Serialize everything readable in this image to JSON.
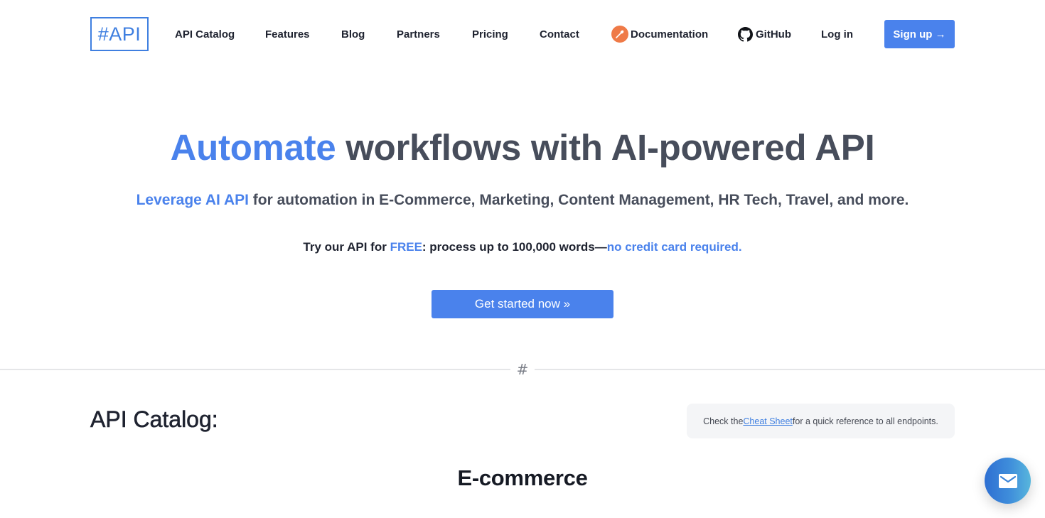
{
  "nav": {
    "logo": "#API",
    "links": [
      {
        "label": "API Catalog"
      },
      {
        "label": "Features"
      },
      {
        "label": "Blog"
      },
      {
        "label": "Partners"
      },
      {
        "label": "Pricing"
      },
      {
        "label": "Contact"
      },
      {
        "label": "Documentation",
        "icon": "postman-icon"
      },
      {
        "label": "GitHub",
        "icon": "github-icon"
      },
      {
        "label": "Log in"
      }
    ],
    "signup_label": "Sign up →"
  },
  "hero": {
    "title_accent": "Automate",
    "title_rest": " workflows with AI-powered API",
    "subtitle_accent": "Leverage AI API",
    "subtitle_rest": " for automation in E-Commerce, Marketing, Content Management, HR Tech, Travel, and more.",
    "free_prefix": "Try our API for ",
    "free_accent": "FREE",
    "free_middle": ": process up to 100,000 words—",
    "free_suffix": "no credit card required.",
    "cta_label": "Get started now »"
  },
  "divider": {
    "symbol": "#"
  },
  "catalog": {
    "title": "API Catalog:",
    "cheat_prefix": "Check the ",
    "cheat_link": "Cheat Sheet ",
    "cheat_suffix": "for a quick reference to all endpoints.",
    "section_title": "E-commerce"
  },
  "chat": {
    "icon": "mail-icon"
  },
  "colors": {
    "accent": "#4a82ec",
    "logo_border": "#3f7fe0",
    "text_dark": "#1f2330",
    "text_gray": "#474d5b",
    "postman_orange": "#ef7a47"
  }
}
